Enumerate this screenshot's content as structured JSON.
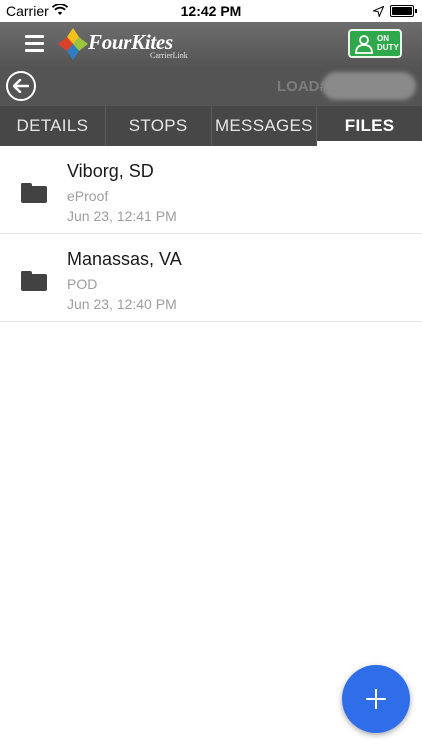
{
  "status_bar": {
    "carrier": "Carrier",
    "time": "12:42 PM"
  },
  "header": {
    "app_name": "FourKites",
    "app_subtitle": "CarrierLink",
    "duty_status": "ON DUTY"
  },
  "load": {
    "label": "LOAD#"
  },
  "tabs": [
    {
      "label": "DETAILS",
      "active": false
    },
    {
      "label": "STOPS",
      "active": false
    },
    {
      "label": "MESSAGES",
      "active": false
    },
    {
      "label": "FILES",
      "active": true
    }
  ],
  "files": [
    {
      "title": "Viborg, SD",
      "type": "eProof",
      "date": "Jun 23, 12:41 PM"
    },
    {
      "title": "Manassas, VA",
      "type": "POD",
      "date": "Jun 23, 12:40 PM"
    }
  ],
  "icons": {
    "menu": "hamburger-icon",
    "back": "back-arrow-icon",
    "duty": "person-icon",
    "folder": "folder-icon",
    "add": "plus-icon"
  },
  "colors": {
    "header": "#5f5f5f",
    "tabs": "#474747",
    "duty_green": "#2ea84a",
    "fab_blue": "#2f6ee8"
  }
}
